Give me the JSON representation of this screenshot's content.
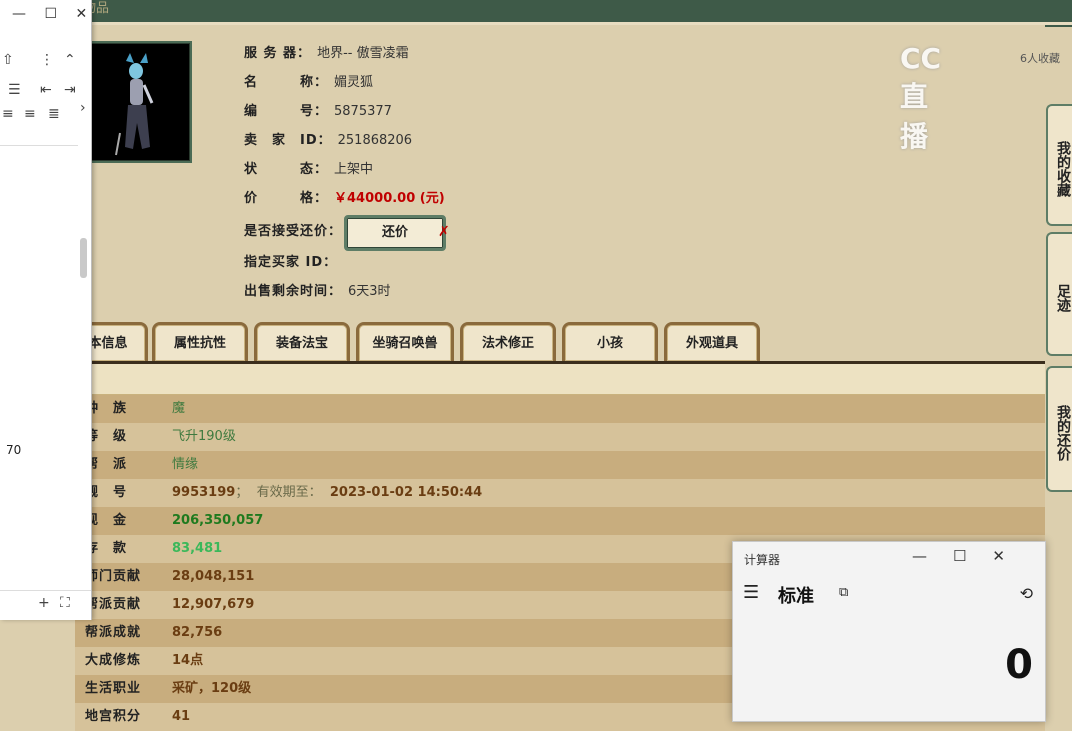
{
  "title": "藏宝阁物品",
  "listing": {
    "server_label": "服 务 器：",
    "server": "地界-- 傲雪凌霜",
    "name_label": "名　　　称：",
    "name": "媚灵狐",
    "id_label": "编　　　号：",
    "id": "5875377",
    "seller_label": "卖　家　ID：",
    "seller": "251868206",
    "status_label": "状　　　态：",
    "status": "上架中",
    "price_label": "价　　　格：",
    "price": "￥44000.00 (元)",
    "counter_label": "是否接受还价：",
    "counter_btn": "还价",
    "buyer_label": "指定买家 ID：",
    "time_label": "出售剩余时间：",
    "time_left": "6天3时"
  },
  "watermark": {
    "logo": "CC直播",
    "favorites": "6人收藏"
  },
  "side_tabs": [
    "我的收藏",
    "足迹",
    "我的还价"
  ],
  "tabs": [
    "本信息",
    "属性抗性",
    "装备法宝",
    "坐骑召唤兽",
    "法术修正",
    "小孩",
    "外观道具"
  ],
  "rows": [
    {
      "k": "种　族",
      "v": "魔",
      "style": "vgreen"
    },
    {
      "k": "等　级",
      "v": "飞升190级",
      "style": "vgreen"
    },
    {
      "k": "帮　派",
      "v": "情缘",
      "style": "vgreen"
    },
    {
      "k": "靓　号",
      "v": "9953199",
      "extra": "；  有效期至：  ",
      "extra2": "2023-01-02 14:50:44",
      "style": "vbrown"
    },
    {
      "k": "现　金",
      "v": "206,350,057",
      "style": "vbold-green"
    },
    {
      "k": "存　款",
      "v": "83,481",
      "style": "vlight-green"
    },
    {
      "k": "师门贡献",
      "v": "28,048,151",
      "style": "vbrown"
    },
    {
      "k": "帮派贡献",
      "v": "12,907,679",
      "style": "vbrown"
    },
    {
      "k": "帮派成就",
      "v": "82,756",
      "style": "vbrown"
    },
    {
      "k": "大成修炼",
      "v": "14点",
      "style": "vbrown"
    },
    {
      "k": "生活职业",
      "v": "采矿，120级",
      "style": "vbrown"
    },
    {
      "k": "地宫积分",
      "v": "41",
      "style": "vbrown"
    }
  ],
  "leftwin": {
    "number": "70"
  },
  "calculator": {
    "title": "计算器",
    "mode": "标准",
    "display": "0"
  }
}
